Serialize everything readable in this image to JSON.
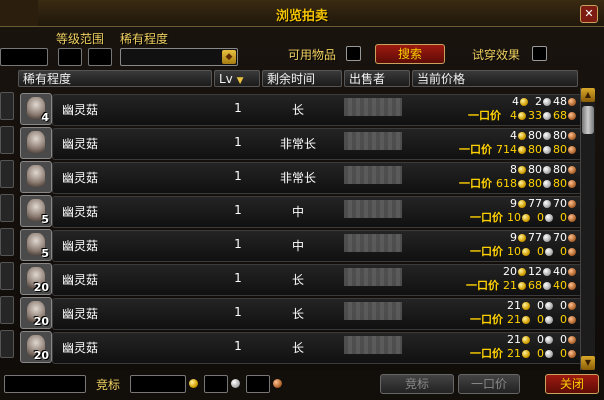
{
  "window": {
    "title": "浏览拍卖",
    "close_glyph": "✕"
  },
  "filters": {
    "level_range_label": "等级范围",
    "level_min": "",
    "level_max": "",
    "rarity_label": "稀有程度",
    "rarity_value": "",
    "usable_label": "可用物品",
    "search_label": "搜索",
    "preview_label": "试穿效果"
  },
  "columns": {
    "rarity": "稀有程度",
    "lv": "Lv",
    "time_left": "剩余时间",
    "seller": "出售者",
    "price": "当前价格"
  },
  "buyout_label": "一口价",
  "rows": [
    {
      "name": "幽灵菇",
      "stack": "4",
      "lv": "1",
      "time": "长",
      "bid": {
        "g": "4",
        "s": "2",
        "c": "48"
      },
      "buyout": {
        "g": "4",
        "s": "33",
        "c": "68"
      }
    },
    {
      "name": "幽灵菇",
      "stack": "",
      "lv": "1",
      "time": "非常长",
      "bid": {
        "g": "4",
        "s": "80",
        "c": "80"
      },
      "buyout": {
        "g": "714",
        "s": "80",
        "c": "80"
      }
    },
    {
      "name": "幽灵菇",
      "stack": "",
      "lv": "1",
      "time": "非常长",
      "bid": {
        "g": "8",
        "s": "80",
        "c": "80"
      },
      "buyout": {
        "g": "618",
        "s": "80",
        "c": "80"
      }
    },
    {
      "name": "幽灵菇",
      "stack": "5",
      "lv": "1",
      "time": "中",
      "bid": {
        "g": "9",
        "s": "77",
        "c": "70"
      },
      "buyout": {
        "g": "10",
        "s": "0",
        "c": "0"
      }
    },
    {
      "name": "幽灵菇",
      "stack": "5",
      "lv": "1",
      "time": "中",
      "bid": {
        "g": "9",
        "s": "77",
        "c": "70"
      },
      "buyout": {
        "g": "10",
        "s": "0",
        "c": "0"
      }
    },
    {
      "name": "幽灵菇",
      "stack": "20",
      "lv": "1",
      "time": "长",
      "bid": {
        "g": "20",
        "s": "12",
        "c": "40"
      },
      "buyout": {
        "g": "21",
        "s": "68",
        "c": "40"
      }
    },
    {
      "name": "幽灵菇",
      "stack": "20",
      "lv": "1",
      "time": "长",
      "bid": {
        "g": "21",
        "s": "0",
        "c": "0"
      },
      "buyout": {
        "g": "21",
        "s": "0",
        "c": "0"
      }
    },
    {
      "name": "幽灵菇",
      "stack": "20",
      "lv": "1",
      "time": "长",
      "bid": {
        "g": "21",
        "s": "0",
        "c": "0"
      },
      "buyout": {
        "g": "21",
        "s": "0",
        "c": "0"
      }
    }
  ],
  "bottom": {
    "bid_label": "竞标",
    "bid_button": "竞标",
    "buyout_button": "一口价",
    "close_button": "关闭"
  },
  "icons": {
    "item": "ghost-mushroom-icon",
    "gold": "gold-coin-icon",
    "silver": "silver-coin-icon",
    "copper": "copper-coin-icon"
  },
  "colors": {
    "gold_text": "#ffd200",
    "title": "#f5c400",
    "search_button": "#9d1a10"
  }
}
